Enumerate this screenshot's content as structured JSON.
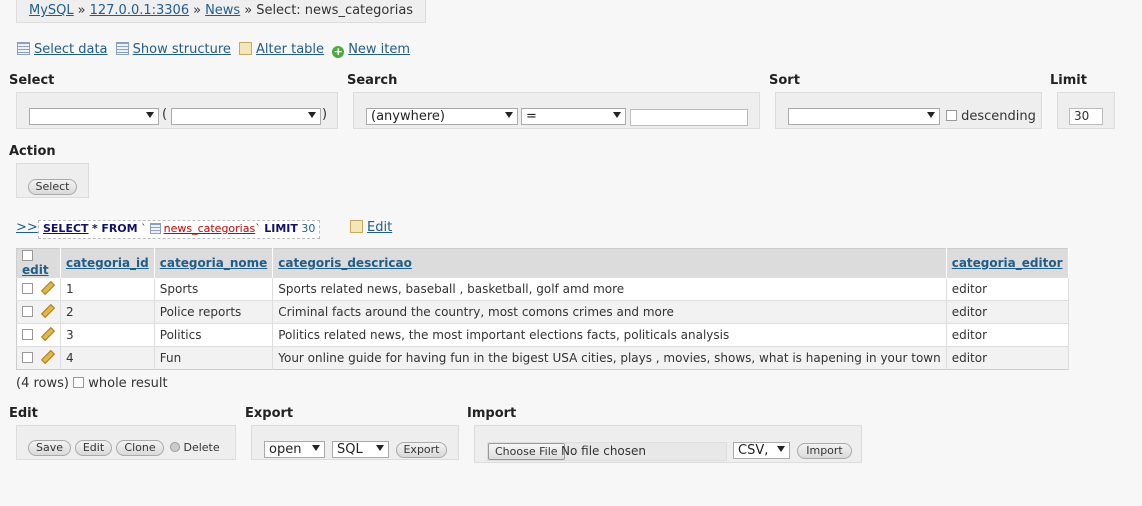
{
  "breadcrumb": {
    "server": "MySQL",
    "host": "127.0.0.1:3306",
    "db": "News",
    "current": "Select: news_categorias",
    "sep": "»"
  },
  "toplinks": {
    "select_data": "Select data",
    "show_structure": "Show structure",
    "alter_table": "Alter table",
    "new_item": "New item"
  },
  "select": {
    "label": "Select",
    "open_paren": "(",
    "close_paren": ")"
  },
  "search": {
    "label": "Search",
    "column": "(anywhere)",
    "operator": "="
  },
  "sort": {
    "label": "Sort",
    "descending": "descending"
  },
  "limit": {
    "label": "Limit",
    "value": "30"
  },
  "action": {
    "label": "Action",
    "select_button": "Select"
  },
  "sql": {
    "toggle": ">>",
    "select_kw": "SELECT",
    "star": "*",
    "from_kw": "FROM",
    "tick_open": "`",
    "table": "news_categorias",
    "tick_close": "`",
    "limit_kw": "LIMIT",
    "limit_val": "30",
    "edit": "Edit"
  },
  "table": {
    "edit_header": "edit",
    "columns": [
      "categoria_id",
      "categoria_nome",
      "categoris_descricao",
      "categoria_editor"
    ],
    "rows": [
      [
        "1",
        "Sports",
        "Sports related news, baseball , basketball, golf amd more",
        "editor"
      ],
      [
        "2",
        "Police reports",
        "Criminal facts around the country, most comons crimes and more",
        "editor"
      ],
      [
        "3",
        "Politics",
        "Politics related news, the most important elections facts, politicals analysis",
        "editor"
      ],
      [
        "4",
        "Fun",
        "Your online guide for having fun in the bigest USA cities, plays , movies, shows, what is hapening in your town",
        "editor"
      ]
    ]
  },
  "summary": {
    "rows": "(4 rows)",
    "whole_result": "whole result"
  },
  "edit": {
    "label": "Edit",
    "save": "Save",
    "edit": "Edit",
    "clone": "Clone",
    "delete": "Delete"
  },
  "export": {
    "label": "Export",
    "target": "open",
    "format": "SQL",
    "button": "Export"
  },
  "import": {
    "label": "Import",
    "choose_file": "Choose File",
    "no_file": "No file chosen",
    "format": "CSV,",
    "button": "Import"
  }
}
